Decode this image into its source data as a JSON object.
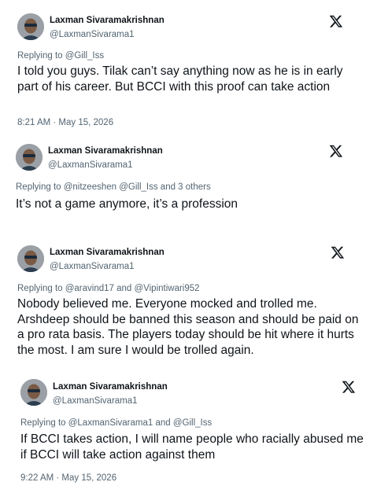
{
  "tweets": [
    {
      "name": "Laxman Sivaramakrishnan",
      "handle": "@LaxmanSivarama1",
      "replying_to": "Replying to @Gill_Iss",
      "text": "I told you guys. Tilak can’t say anything now as he is in early part of his career. But BCCI with this proof can take action",
      "timestamp": "8:21 AM · May 15, 2026"
    },
    {
      "name": "Laxman Sivaramakrishnan",
      "handle": "@LaxmanSivarama1",
      "replying_to": "Replying to @nitzeeshen @Gill_Iss and 3 others",
      "text": "It’s not a game anymore, it’s a profession"
    },
    {
      "name": "Laxman Sivaramakrishnan",
      "handle": "@LaxmanSivarama1",
      "replying_to": "Replying to @aravind17 and @Vipintiwari952",
      "text": "Nobody believed me. Everyone mocked and trolled me. Arshdeep should be banned this season and should be paid on a pro rata basis. The players today should be hit where it hurts the most. I am sure I would be trolled again."
    },
    {
      "name": "Laxman Sivaramakrishnan",
      "handle": "@LaxmanSivarama1",
      "replying_to": "Replying to @LaxmanSivarama1 and @Gill_Iss",
      "text": "If BCCI takes action, I will name people who racially abused me if BCCI will take action against them",
      "timestamp": "9:22 AM · May 15, 2026"
    }
  ],
  "icons": {
    "avatar": "avatar-photo",
    "brand": "x-logo-icon"
  },
  "colors": {
    "text": "#0f1419",
    "secondary": "#536471"
  }
}
